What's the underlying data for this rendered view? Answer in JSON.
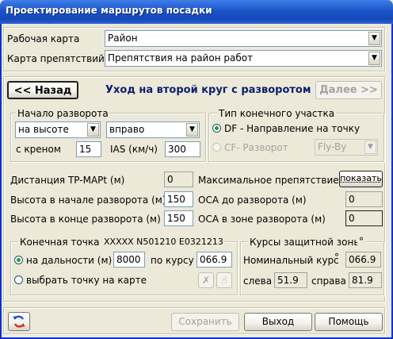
{
  "window": {
    "title": "Проектирование маршрутов посадки"
  },
  "top": {
    "map_label": "Рабочая карта",
    "map_value": "Район",
    "obstacle_label": "Карта препятствий",
    "obstacle_value": "Препятствия на район работ"
  },
  "nav": {
    "back_label": "<< Назад",
    "heading": "Уход на второй круг с разворотом",
    "next_label": "Далее >>"
  },
  "turn_start": {
    "title": "Начало разворота",
    "mode_value": "на высоте",
    "direction_value": "вправо",
    "bank_label": "с креном",
    "bank_value": "15",
    "ias_label": "IAS (км/ч)",
    "ias_value": "300"
  },
  "final_segment": {
    "title": "Тип конечного участка",
    "df_label": "DF - Направление на точку",
    "cf_label": "CF- Разворот",
    "flyby_value": "Fly-By"
  },
  "params": {
    "tr_label": "Дистанция TP-MAPt (м)",
    "tr_value": "0",
    "h_start_label": "Высота в начале разворота (м)",
    "h_start_value": "150",
    "h_end_label": "Высота в конце разворота (м)",
    "h_end_value": "150",
    "max_obst_label": "Максимальное препятствие",
    "show_label": "показать",
    "oca_before_label": "ОСА до разворота (м)",
    "oca_before_value": "0",
    "oca_zone_label": "ОСА в зоне разворота (м)",
    "oca_zone_value": "0"
  },
  "endpoint": {
    "title": "Конечная точка",
    "coords": "XXXXX N501210 E0321213",
    "distance_label": "на дальности (м)",
    "distance_value": "8000",
    "course_label": "по курсу",
    "course_value": "066.9",
    "pick_label": "выбрать точку на карте"
  },
  "courses": {
    "title": "Курсы защитной зоны",
    "degree": "°",
    "nominal_label": "Номинальный курс",
    "nominal_value": "066.9",
    "left_label": "слева",
    "left_value": "51.9",
    "right_label": "справа",
    "right_value": "81.9"
  },
  "bottom": {
    "save_label": "Сохранить",
    "exit_label": "Выход",
    "help_label": "Помощь"
  }
}
